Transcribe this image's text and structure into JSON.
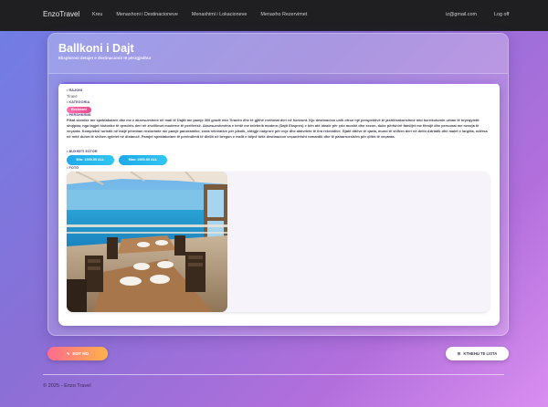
{
  "navbar": {
    "brand": "EnzoTravel",
    "items": [
      {
        "label": "Kreu"
      },
      {
        "label": "Menaxhoni i Destinacioneve"
      },
      {
        "label": "Menaxhimi i Lokacioneve"
      },
      {
        "label": "Menaxho Rezervimet"
      }
    ],
    "user_email": "iz@gmail.com",
    "logout_label": "Log off"
  },
  "header": {
    "title": "Ballkoni i Dajt",
    "subtitle": "Eksploroni detajet e destinacionit të përzgjedhur"
  },
  "details": {
    "rajoni_label": "• RAJONI",
    "rajoni_value": "Tiranë",
    "kategoria_label": "• KATEGORIA",
    "kategoria_value": "Restorant",
    "pershkrimi_label": "• PERSHKRIMI",
    "pershkrimi_text": "Pikat skenike me spektakolare dhe me e aksesueshme në mali të Dajtit me pamje 360 gradë mbi Tiranën dhe të gjithë rrethinat deri në horizont. Kjo destinacion unik ofron një perspektivë të jashtëzakonshme mbi kurrikulumin urban të kryeqytetit shqiptar, nga lagjet historike të qendrës deri në zhvillimet moderne të periferisë. Aksesueshmëria e lehtë me teleferik modern (Dajti Ekspres) e bën atë ideale për çdo moshë dhe sezon, duke përfshirë familjet me fëmijë dhe personat me nevoja të veçanta. Kompleksi turistik në majë përmban restorante me pamje panoramike, zona rekreative për piknik, shtigje natyrore për ecje dhe aktivitete të lira rekreative. Gjatë ditëve të qarta, mund të shihen deri në detin Adriatik dhe malet e largëta, ndërsa në netë duhet të shihen qytetet në distancë. Pamjet spektakolare të perëndimit të diellit në bregun e malit e bëjnë këtë destinacion veçanërisht romantik dhe të paharrueshëm për çiftet të veçanta.",
    "buxheti_label": "• BUXHETI ESTOR",
    "price_min": "Min: 1000.00 ALL",
    "price_max": "Max: 2000.00 ALL",
    "foto_label": "• FOTO"
  },
  "actions": {
    "edit_label": "EDIT MO",
    "back_label": "KTHEHU TE LISTA"
  },
  "footer": {
    "text": "© 2025 - Enzo Travel"
  },
  "icons": {
    "edit": "pencil-icon",
    "back": "list-icon"
  },
  "colors": {
    "navbar_bg": "#1f1f22",
    "badge": "#ff6fb0",
    "price_pill": "#1fa9e8",
    "edit_button": "#ff6b8e"
  }
}
